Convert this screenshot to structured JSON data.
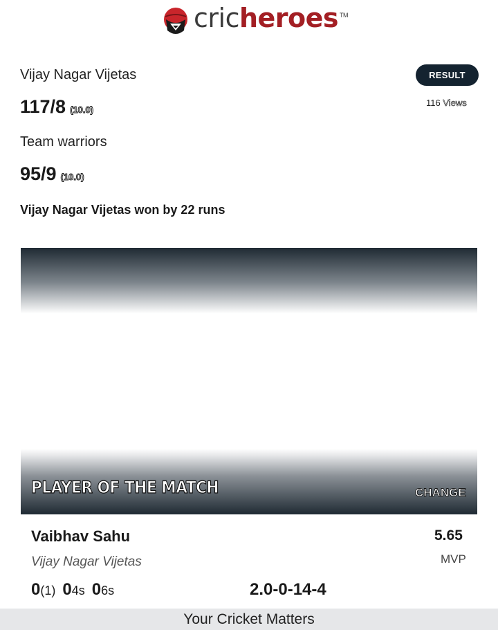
{
  "header": {
    "logo_icon": "cricket-ball-helmet-icon",
    "logo_cric": "cric",
    "logo_heroes": "heroes",
    "logo_tm": "TM",
    "colors": {
      "brand_red": "#a31f24",
      "dark_text": "#3a3a3a"
    }
  },
  "match": {
    "team1": {
      "name": "Vijay Nagar Vijetas",
      "score": "117/8",
      "overs": "(10.0)"
    },
    "team2": {
      "name": "Team warriors",
      "score": "95/9",
      "overs": "(10.0)"
    },
    "status_badge": "RESULT",
    "views_count": "116",
    "views_label": "Views",
    "result_text": "Vijay Nagar Vijetas won by 22 runs",
    "colors": {
      "badge_bg": "#142330"
    }
  },
  "player_of_match": {
    "title": "PLAYER OF THE MATCH",
    "change_label": "CHANGE",
    "name": "Vaibhav Sahu",
    "team": "Vijay Nagar Vijetas",
    "mvp_score": "5.65",
    "mvp_label": "MVP",
    "batting": {
      "runs": "0",
      "balls": "(1)",
      "fours": "0",
      "fours_label": "4s",
      "sixes": "0",
      "sixes_label": "6s"
    },
    "bowling_figures": "2.0-0-14-4"
  },
  "footer": {
    "tagline": "Your Cricket Matters"
  }
}
